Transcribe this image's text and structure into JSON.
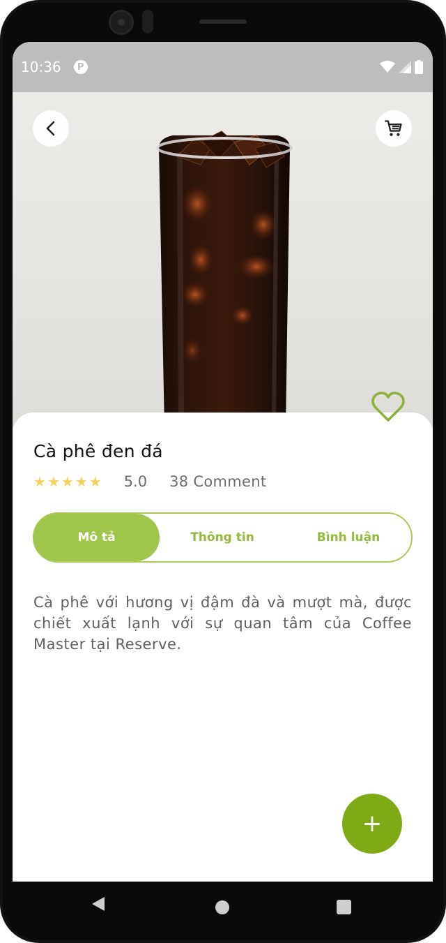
{
  "status_bar": {
    "time": "10:36",
    "app_icon_letter": "P",
    "icons": [
      "wifi-icon",
      "signal-icon",
      "battery-icon"
    ]
  },
  "header": {
    "back_icon": "chevron-left-icon",
    "cart_icon": "shopping-cart-icon"
  },
  "product": {
    "name": "Cà phê đen đá",
    "stars": [
      "★",
      "★",
      "★",
      "★",
      "★"
    ],
    "rating": "5.0",
    "comments": "38 Comment",
    "favorite_icon": "heart-outline-icon"
  },
  "tabs": [
    {
      "label": "Mô tả",
      "active": true
    },
    {
      "label": "Thông tin",
      "active": false
    },
    {
      "label": "Bình luận",
      "active": false
    }
  ],
  "description": "Cà phê với hương vị đậm đà và mượt mà, được chiết xuất lạnh với sự quan tâm của Coffee Master tại Reserve.",
  "fab": {
    "label": "+"
  },
  "colors": {
    "accent": "#9fc64a",
    "fab": "#80aa15",
    "star": "#f3d15a",
    "status_bar": "#bdbdbd"
  },
  "nav_bar": {
    "icons": [
      "back-triangle-icon",
      "home-circle-icon",
      "recents-square-icon"
    ]
  }
}
